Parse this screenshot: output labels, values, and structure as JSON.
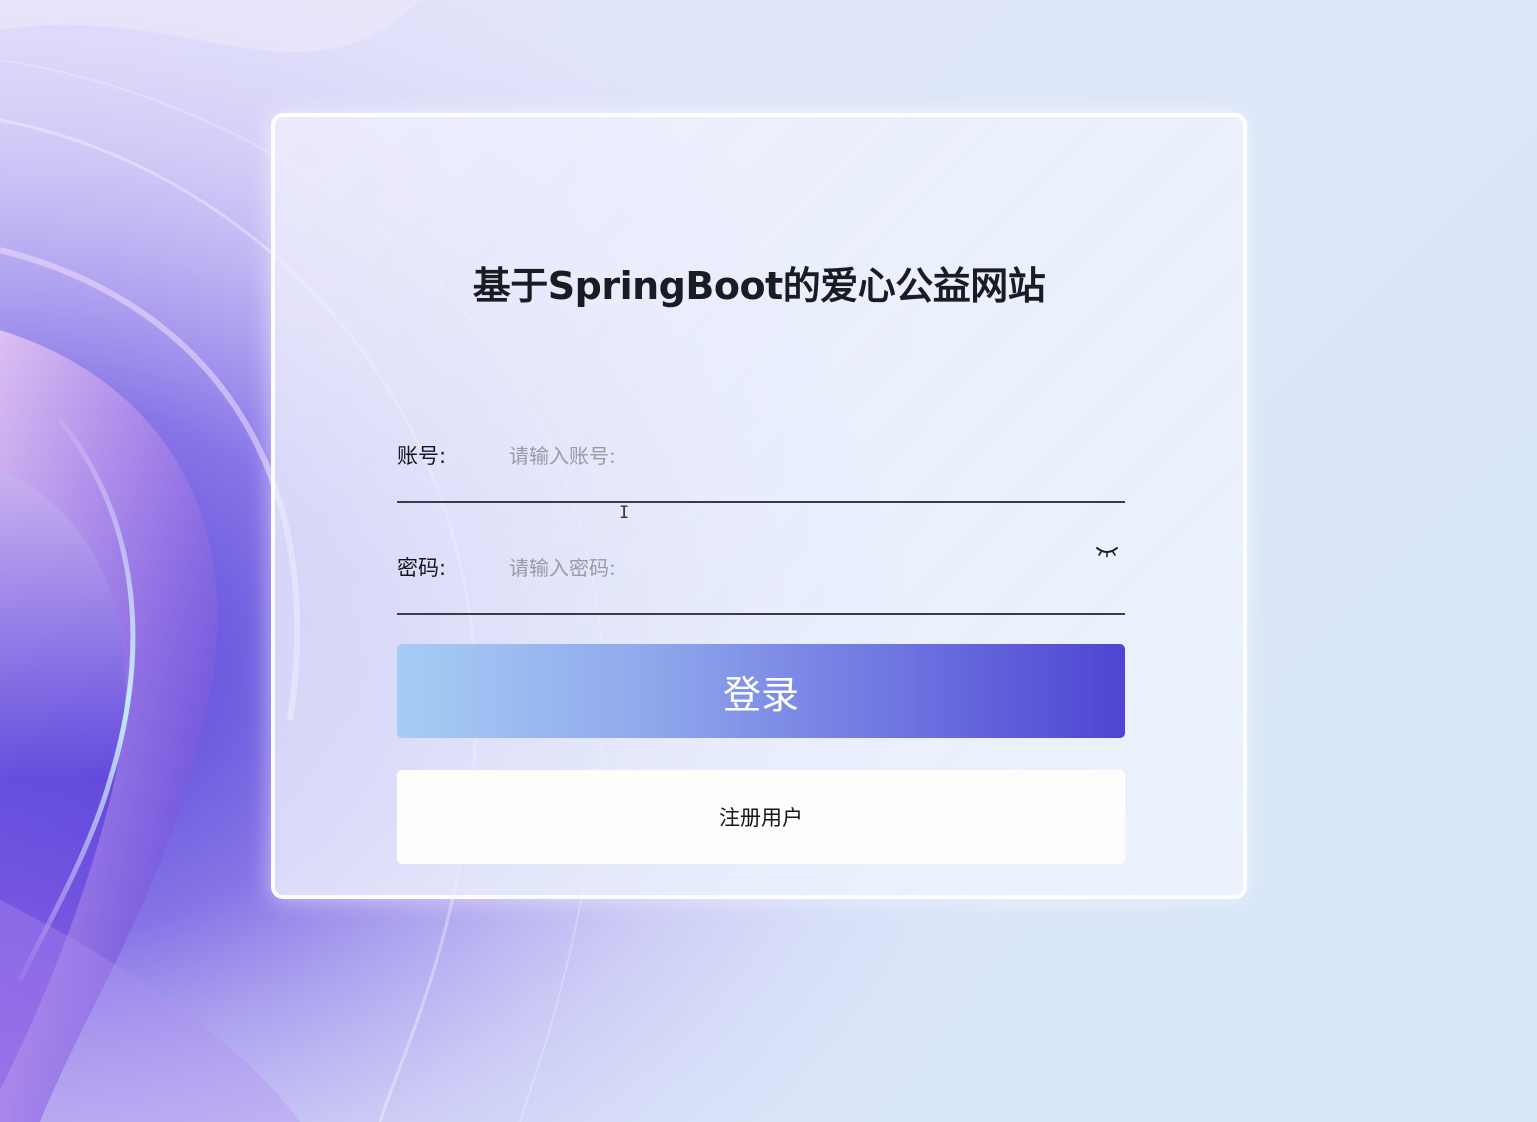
{
  "page": {
    "title": "基于SpringBoot的爱心公益网站"
  },
  "login_form": {
    "account": {
      "label": "账号:",
      "placeholder": "请输入账号:",
      "value": ""
    },
    "password": {
      "label": "密码:",
      "placeholder": "请输入密码:",
      "value": "",
      "visibility_icon": "eye-closed-icon"
    },
    "login_button": "登录",
    "register_button": "注册用户"
  },
  "colors": {
    "login_gradient_start": "#a6cdf4",
    "login_gradient_end": "#4e44d2",
    "register_bg": "#fdfdfb",
    "title_text": "#1b1b24",
    "background": "#dde6f9"
  }
}
